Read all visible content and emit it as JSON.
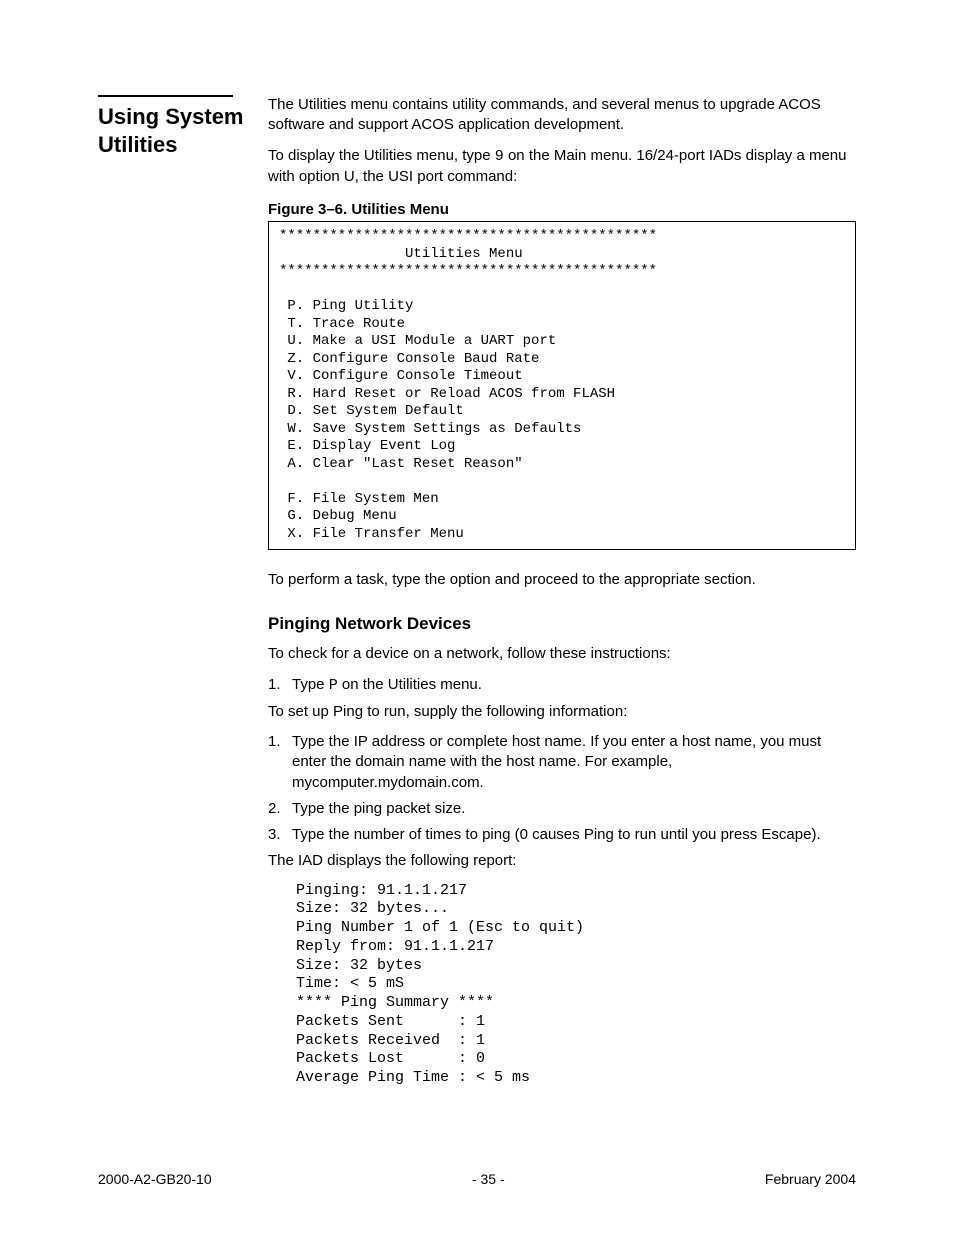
{
  "side_heading": "Using System Utilities",
  "intro_p1": "The Utilities menu contains utility commands, and several menus to upgrade ACOS software and support ACOS application development.",
  "intro_p2a": "To display the Utilities menu, type ",
  "intro_p2_code": "9",
  "intro_p2b": " on the Main menu. 16/24-port IADs display a menu with option U, the USI port command:",
  "figure_caption": "Figure 3–6.  Utilities Menu",
  "menu_text": "*********************************************\n               Utilities Menu\n*********************************************\n\n P. Ping Utility\n T. Trace Route\n U. Make a USI Module a UART port\n Z. Configure Console Baud Rate\n V. Configure Console Timeout\n R. Hard Reset or Reload ACOS from FLASH\n D. Set System Default\n W. Save System Settings as Defaults\n E. Display Event Log\n A. Clear \"Last Reset Reason\"\n\n F. File System Men\n G. Debug Menu\n X. File Transfer Menu",
  "after_menu": "To perform a task, type the option and proceed to the appropriate section.",
  "sub_heading": "Pinging Network Devices",
  "sub_p1": "To check for a device on a network, follow these instructions:",
  "step1_num": "1.",
  "step1_a": "Type ",
  "step1_code": "P",
  "step1_b": " on the Utilities menu.",
  "sub_p2": "To set up Ping to run, supply the following information:",
  "list2": [
    {
      "num": "1.",
      "text": "Type the IP address or complete host name. If you enter a host name, you must enter the domain name with the host name. For example, mycomputer.mydomain.com."
    },
    {
      "num": "2.",
      "text": "Type the ping packet size."
    },
    {
      "num": "3.",
      "text": "Type the number of times to ping (0 causes Ping to run until you press Escape)."
    }
  ],
  "sub_p3": "The IAD displays the following report:",
  "ping_output": "Pinging: 91.1.1.217\nSize: 32 bytes...\nPing Number 1 of 1 (Esc to quit)\nReply from: 91.1.1.217\nSize: 32 bytes\nTime: < 5 mS\n**** Ping Summary ****\nPackets Sent      : 1\nPackets Received  : 1\nPackets Lost      : 0\nAverage Ping Time : < 5 ms",
  "footer_left": "2000-A2-GB20-10",
  "footer_center": "- 35 -",
  "footer_right": "February 2004"
}
